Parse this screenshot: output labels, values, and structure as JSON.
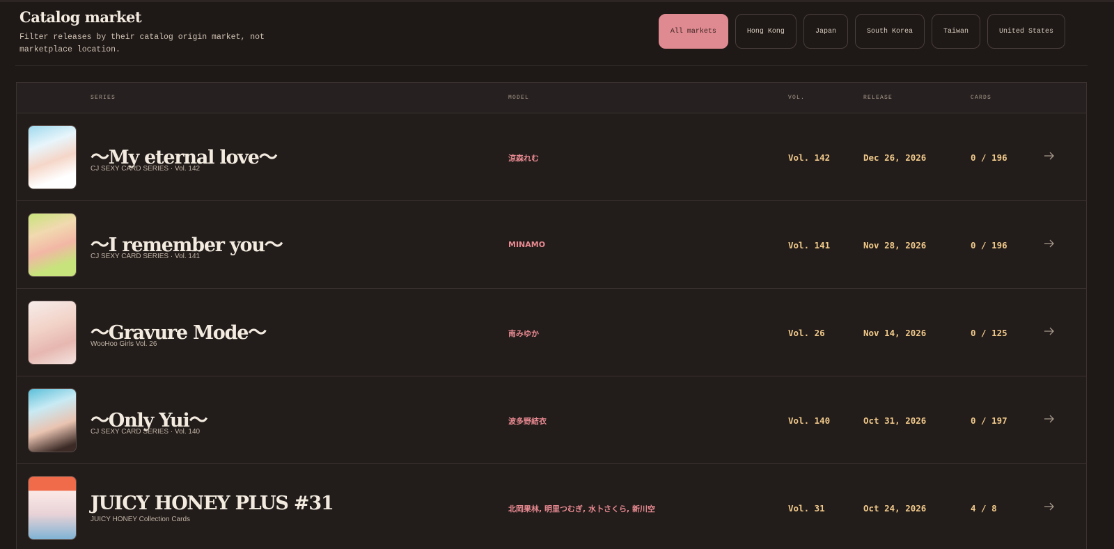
{
  "header": {
    "title": "Catalog market",
    "description": "Filter releases by their catalog origin market, not marketplace location."
  },
  "filters": [
    {
      "label": "All markets",
      "active": true
    },
    {
      "label": "Hong Kong",
      "active": false
    },
    {
      "label": "Japan",
      "active": false
    },
    {
      "label": "South Korea",
      "active": false
    },
    {
      "label": "Taiwan",
      "active": false
    },
    {
      "label": "United States",
      "active": false
    }
  ],
  "table": {
    "columns": {
      "series": "SERIES",
      "model": "MODEL",
      "vol": "VOL.",
      "release": "RELEASE",
      "cards": "CARDS"
    },
    "rows": [
      {
        "title": "〜My eternal love〜",
        "subtitle": "CJ SEXY CARD SERIES · Vol. 142",
        "model": "涼森れむ",
        "vol": "Vol. 142",
        "release": "Dec 26, 2026",
        "cards": "0 / 196",
        "thumb_icon": "cover-photo-icon"
      },
      {
        "title": "〜I remember you〜",
        "subtitle": "CJ SEXY CARD SERIES · Vol. 141",
        "model": "MINAMO",
        "vol": "Vol. 141",
        "release": "Nov 28, 2026",
        "cards": "0 / 196",
        "thumb_icon": "cover-photo-icon"
      },
      {
        "title": "〜Gravure Mode〜",
        "subtitle": "WooHoo Girls Vol. 26",
        "model": "南みゆか",
        "vol": "Vol. 26",
        "release": "Nov 14, 2026",
        "cards": "0 / 125",
        "thumb_icon": "cover-photo-icon"
      },
      {
        "title": "〜Only Yui〜",
        "subtitle": "CJ SEXY CARD SERIES · Vol. 140",
        "model": "波多野結衣",
        "vol": "Vol. 140",
        "release": "Oct 31, 2026",
        "cards": "0 / 197",
        "thumb_icon": "cover-photo-icon"
      },
      {
        "title": "JUICY HONEY PLUS #31",
        "subtitle": "JUICY HONEY Collection Cards",
        "model": "北岡果林, 明里つむぎ, 水卜さくら, 新川空",
        "vol": "Vol. 31",
        "release": "Oct 24, 2026",
        "cards": "4 / 8",
        "thumb_icon": "cover-photo-icon"
      }
    ]
  },
  "colors": {
    "background": "#1e1816",
    "accent": "#df8a90",
    "model_text": "#e88a91",
    "numeric_text": "#f0c98a"
  },
  "icons": {
    "row_action": "arrow-right-icon"
  }
}
